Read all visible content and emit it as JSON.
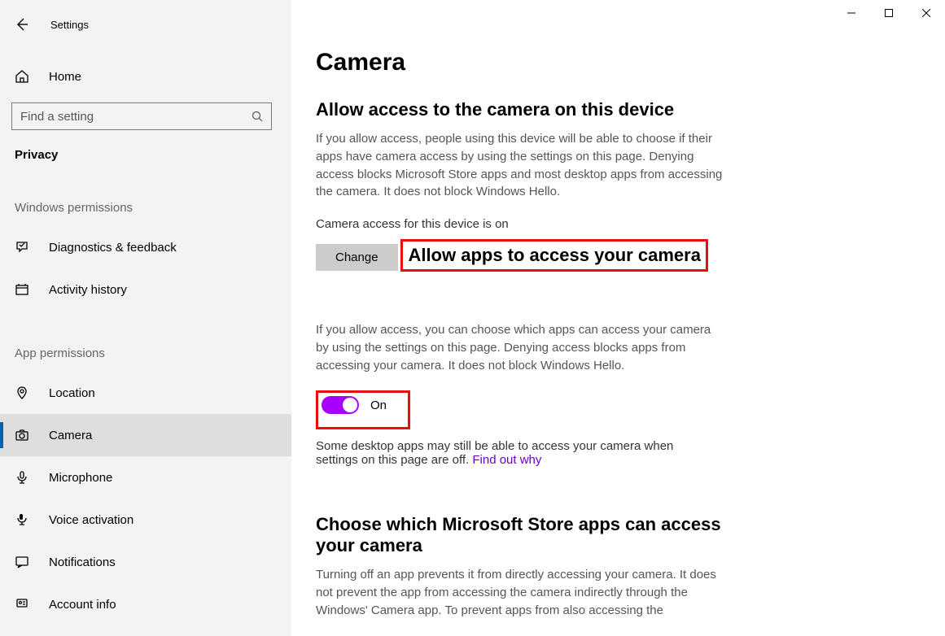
{
  "window": {
    "app_title": "Settings"
  },
  "sidebar": {
    "home": "Home",
    "search_placeholder": "Find a setting",
    "category": "Privacy",
    "group1": {
      "title": "Windows permissions",
      "items": [
        {
          "label": "Diagnostics & feedback"
        },
        {
          "label": "Activity history"
        }
      ]
    },
    "group2": {
      "title": "App permissions",
      "items": [
        {
          "label": "Location"
        },
        {
          "label": "Camera"
        },
        {
          "label": "Microphone"
        },
        {
          "label": "Voice activation"
        },
        {
          "label": "Notifications"
        },
        {
          "label": "Account info"
        }
      ]
    }
  },
  "main": {
    "page_title": "Camera",
    "section1": {
      "title": "Allow access to the camera on this device",
      "desc": "If you allow access, people using this device will be able to choose if their apps have camera access by using the settings on this page. Denying access blocks Microsoft Store apps and most desktop apps from accessing the camera. It does not block Windows Hello.",
      "status": "Camera access for this device is on",
      "change_label": "Change"
    },
    "section2": {
      "title": "Allow apps to access your camera",
      "desc": "If you allow access, you can choose which apps can access your camera by using the settings on this page. Denying access blocks apps from accessing your camera. It does not block Windows Hello.",
      "toggle_state": "On",
      "note_text": "Some desktop apps may still be able to access your camera when settings on this page are off. ",
      "note_link": "Find out why"
    },
    "section3": {
      "title": "Choose which Microsoft Store apps can access your camera",
      "desc": "Turning off an app prevents it from directly accessing your camera. It does not prevent the app from accessing the camera indirectly through the Windows' Camera app. To prevent apps from also accessing the"
    }
  }
}
